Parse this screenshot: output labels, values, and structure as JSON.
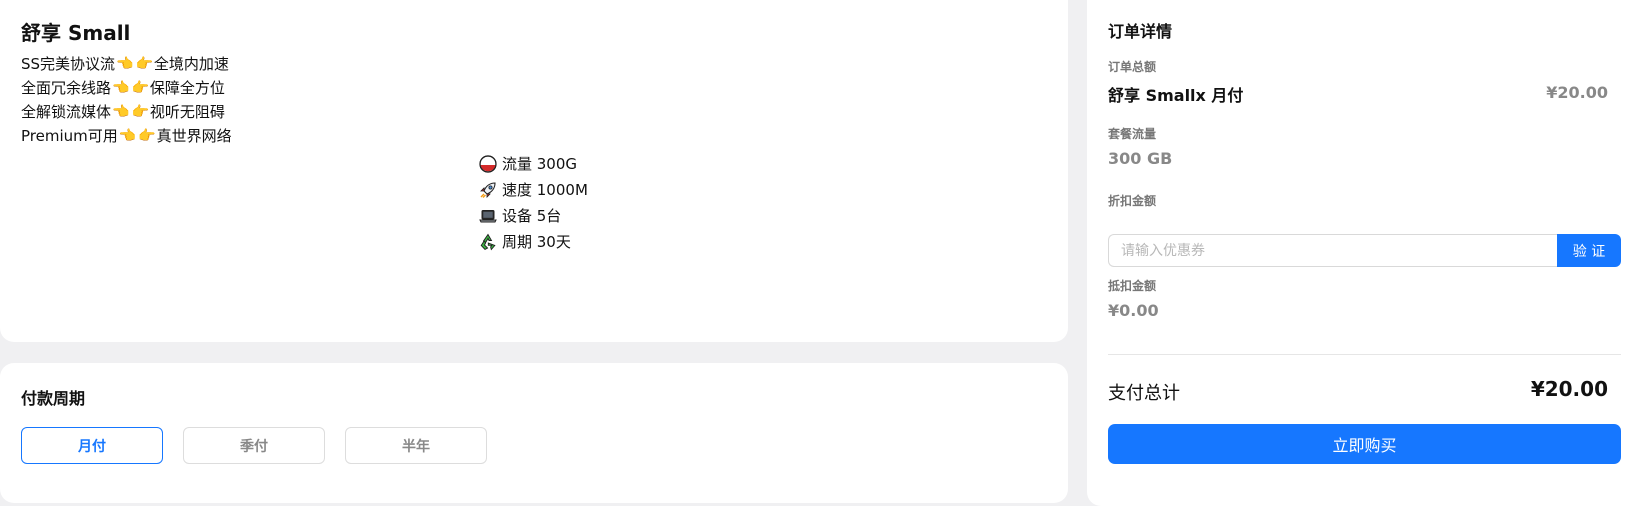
{
  "plan": {
    "title": "舒享 Small",
    "features": [
      {
        "before": "SS完美协议流",
        "after": "全境内加速"
      },
      {
        "before": "全面冗余线路",
        "after": "保障全方位"
      },
      {
        "before": "全解锁流媒体",
        "after": "视听无阻碍"
      },
      {
        "before": "Premium可用",
        "after": "真世界网络"
      }
    ],
    "specs": [
      {
        "icon": "traffic-icon",
        "label": "流量 300G"
      },
      {
        "icon": "rocket-icon",
        "label": "速度 1000M"
      },
      {
        "icon": "laptop-icon",
        "label": "设备 5台"
      },
      {
        "icon": "recycle-icon",
        "label": "周期 30天"
      }
    ]
  },
  "cycle": {
    "title": "付款周期",
    "options": [
      {
        "label": "月付",
        "active": true
      },
      {
        "label": "季付",
        "active": false
      },
      {
        "label": "半年",
        "active": false
      }
    ]
  },
  "order": {
    "title": "订单详情",
    "total_amount_label": "订单总额",
    "item_name": "舒享 Smallx 月付",
    "item_price": "¥20.00",
    "traffic_label": "套餐流量",
    "traffic_value": "300 GB",
    "discount_label": "折扣金额",
    "coupon_placeholder": "请输入优惠券",
    "verify_label": "验 证",
    "deduct_label": "抵扣金额",
    "deduct_value": "¥0.00",
    "total_label": "支付总计",
    "total_value": "¥20.00",
    "buy_label": "立即购买"
  },
  "colors": {
    "accent": "#1677ff",
    "background": "#f0f0f2",
    "muted": "#888888"
  }
}
